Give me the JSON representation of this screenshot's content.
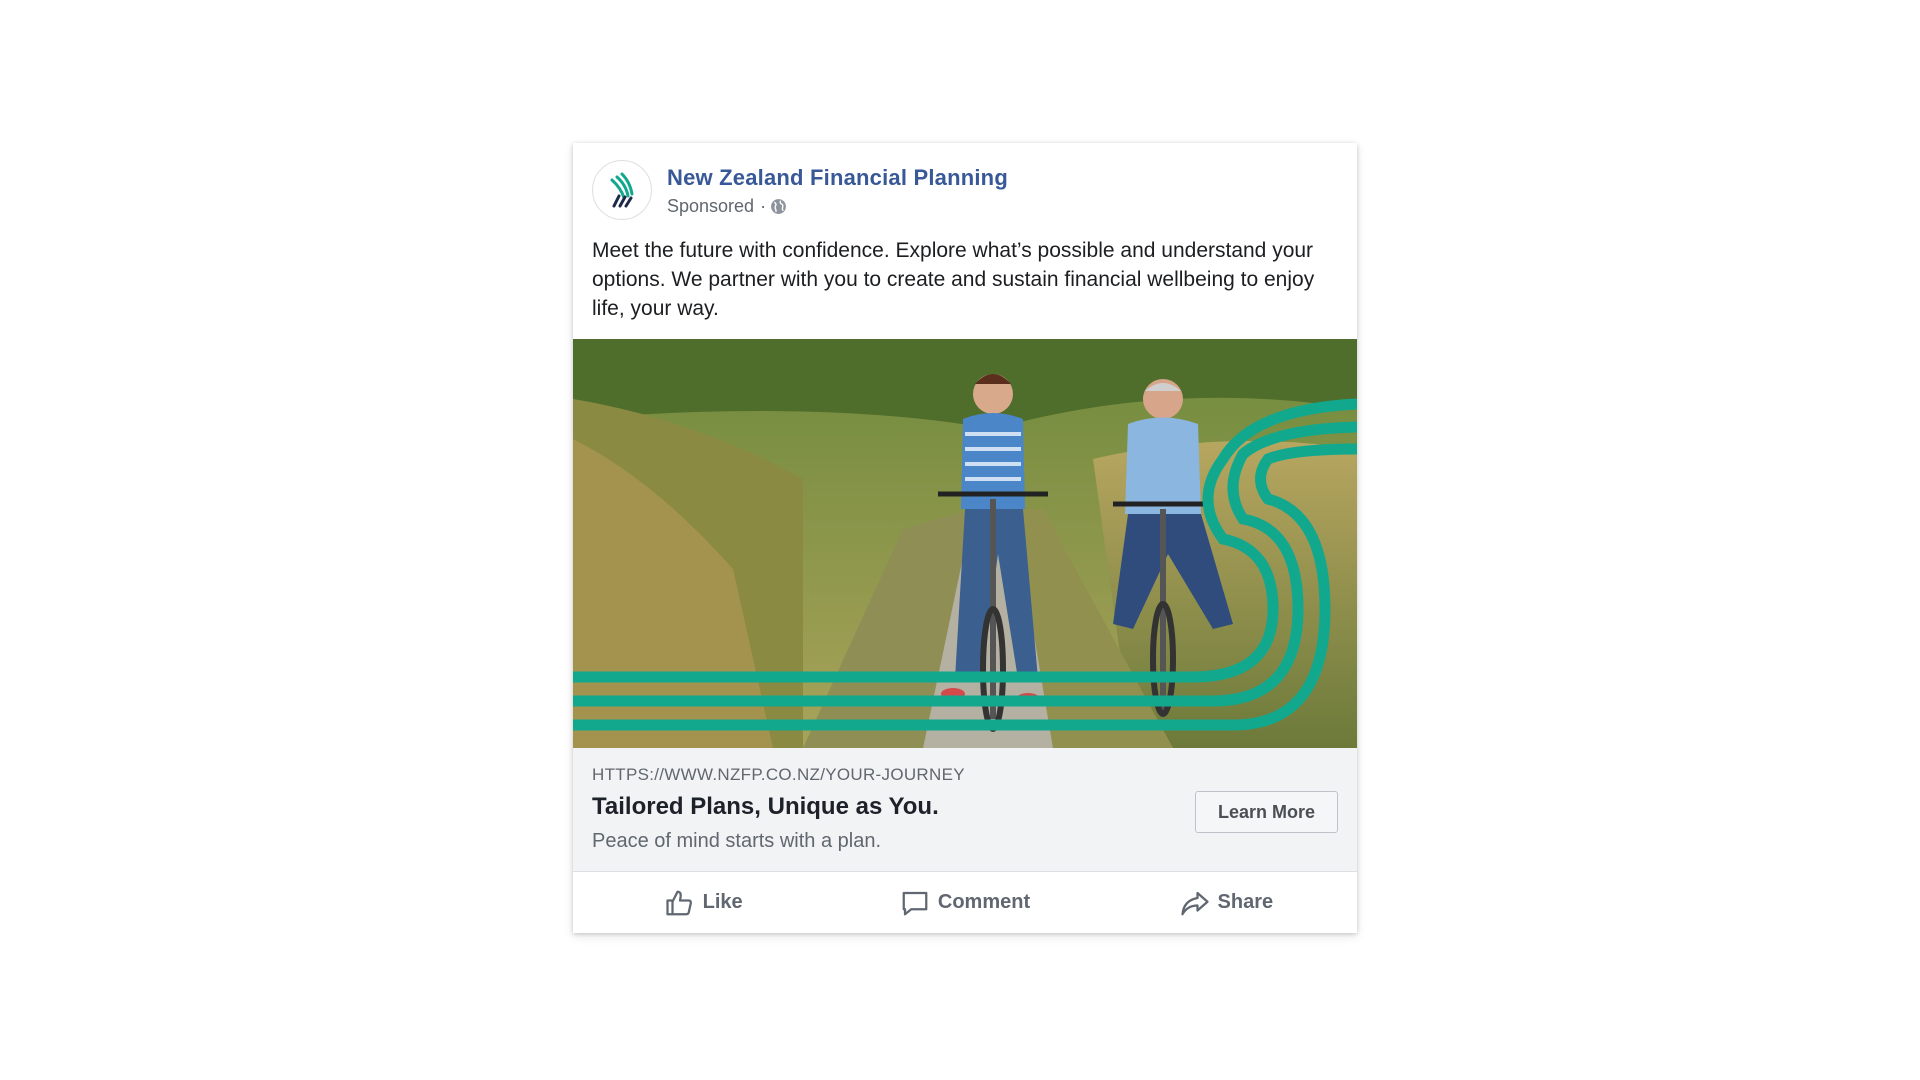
{
  "post": {
    "page_name": "New Zealand Financial Planning",
    "sponsored_label": "Sponsored",
    "separator": "·",
    "body": "Meet the future with confidence. Explore what’s possible and understand your options. We partner with you to create and sustain financial wellbeing to enjoy life, your way."
  },
  "link_preview": {
    "url": "HTTPS://WWW.NZFP.CO.NZ/YOUR-JOURNEY",
    "headline": "Tailored Plans, Unique as You.",
    "description": "Peace of mind starts with a plan.",
    "cta_label": "Learn More"
  },
  "actions": {
    "like": "Like",
    "comment": "Comment",
    "share": "Share"
  },
  "icons": {
    "avatar": "nzfp-logo-icon",
    "privacy": "globe-icon",
    "like": "thumbs-up-icon",
    "comment": "comment-bubble-icon",
    "share": "share-arrow-icon"
  },
  "colors": {
    "page_name": "#385898",
    "brand_teal": "#12a88e",
    "brand_dark": "#1d2a4a",
    "link_area_bg": "#f2f3f5",
    "secondary_text": "#606770"
  }
}
